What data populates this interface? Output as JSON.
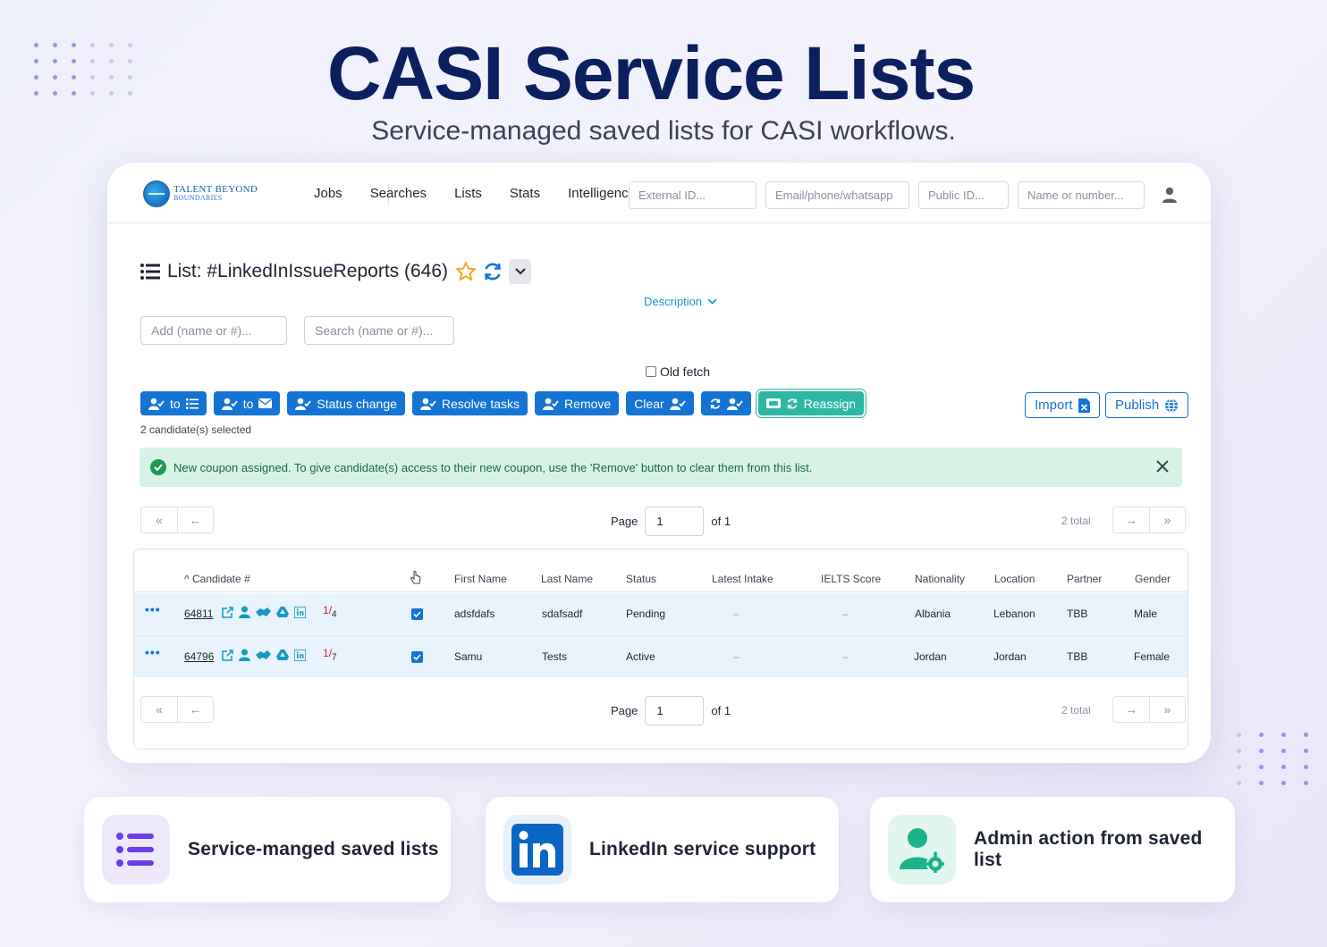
{
  "hero": {
    "title": "CASI Service Lists",
    "subtitle": "Service-managed saved lists for CASI workflows."
  },
  "header": {
    "logo_line1": "TALENT BEYOND",
    "logo_line2": "BOUNDARIES",
    "nav": [
      "Jobs",
      "Searches",
      "Lists",
      "Stats",
      "Intelligence"
    ],
    "active_nav": "Lists",
    "search_external_placeholder": "External ID...",
    "search_email_placeholder": "Email/phone/whatsapp",
    "search_public_placeholder": "Public ID...",
    "search_name_placeholder": "Name or number..."
  },
  "list": {
    "title": "List: #LinkedInIssueReports (646)",
    "description_label": "Description",
    "add_placeholder": "Add (name or #)...",
    "search_placeholder": "Search (name or #)...",
    "old_fetch_label": "Old fetch"
  },
  "actions": {
    "to_list": "to",
    "to_email": "to",
    "status_change": "Status change",
    "resolve_tasks": "Resolve tasks",
    "remove": "Remove",
    "clear": "Clear",
    "reassign": "Reassign",
    "import": "Import",
    "publish": "Publish",
    "selected_text": "2 candidate(s) selected"
  },
  "alert": {
    "message": "New coupon assigned. To give candidate(s) access to their new coupon, use the 'Remove' button to clear them from this list."
  },
  "pager": {
    "page_label": "Page",
    "page_value": "1",
    "of_label": "of 1",
    "total_label": "2 total"
  },
  "table": {
    "columns": {
      "candidate": "Candidate #",
      "first_name": "First Name",
      "last_name": "Last Name",
      "status": "Status",
      "latest_intake": "Latest Intake",
      "ielts": "IELTS Score",
      "nationality": "Nationality",
      "location": "Location",
      "partner": "Partner",
      "gender": "Gender"
    },
    "rows": [
      {
        "candidate": "64811",
        "frac_num": "1",
        "frac_den": "4",
        "first_name": "adsfdafs",
        "last_name": "sdafsadf",
        "status": "Pending",
        "latest_intake": "–",
        "ielts": "–",
        "nationality": "Albania",
        "location": "Lebanon",
        "partner": "TBB",
        "gender": "Male",
        "dots": "•••"
      },
      {
        "candidate": "64796",
        "frac_num": "1",
        "frac_den": "7",
        "first_name": "Samu",
        "last_name": "Tests",
        "status": "Active",
        "latest_intake": "–",
        "ielts": "–",
        "nationality": "Jordan",
        "location": "Jordan",
        "partner": "TBB",
        "gender": "Female",
        "dots": "•••"
      }
    ]
  },
  "features": [
    {
      "label": "Service-manged saved lists",
      "icon": "list-icon",
      "bg": "#ede8fc",
      "color": "#6a3de8"
    },
    {
      "label": "LinkedIn service support",
      "icon": "linkedin-icon",
      "bg": "#e8f1fb",
      "color": "#0a66c2"
    },
    {
      "label": "Admin action from saved list",
      "icon": "admin-user-gear-icon",
      "bg": "#e1f6ee",
      "color": "#1bb38a"
    }
  ],
  "colors": {
    "primary": "#1474d4",
    "reassign": "#2db8a5",
    "hero_title": "#0c1f5f",
    "alert_bg": "#d7f3e6"
  }
}
